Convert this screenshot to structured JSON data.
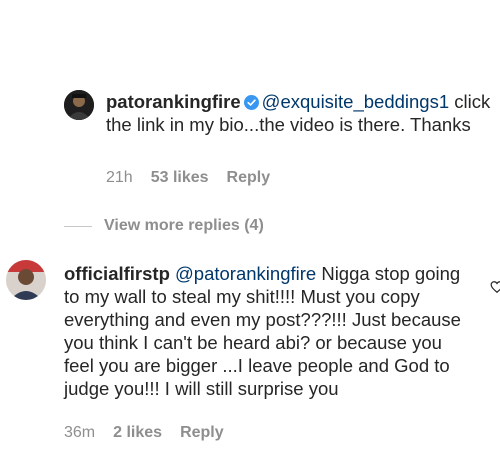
{
  "comments": [
    {
      "username": "patorankingfire",
      "verified": true,
      "mention": "@exquisite_beddings1",
      "text": "click the link in my bio...the video is there. Thanks",
      "time": "21h",
      "likes": "53 likes",
      "reply": "Reply"
    },
    {
      "username": "officialfirstp",
      "mention": "@patorankingfire",
      "text": "Nigga stop going to my wall to steal my shit!!!! Must you copy everything and even my post???!!! Just because you think I can't be heard abi? or because you feel you are bigger ...I leave people and God to judge you!!! I will still surprise you",
      "time": "36m",
      "likes": "2 likes",
      "reply": "Reply"
    }
  ],
  "view_more_replies": "View more replies (4)",
  "colors": {
    "text": "#262626",
    "meta": "#8e8e8e",
    "mention": "#00376b",
    "verified": "#3897f0"
  },
  "icons": [
    "verified-badge-icon",
    "heart-icon"
  ]
}
